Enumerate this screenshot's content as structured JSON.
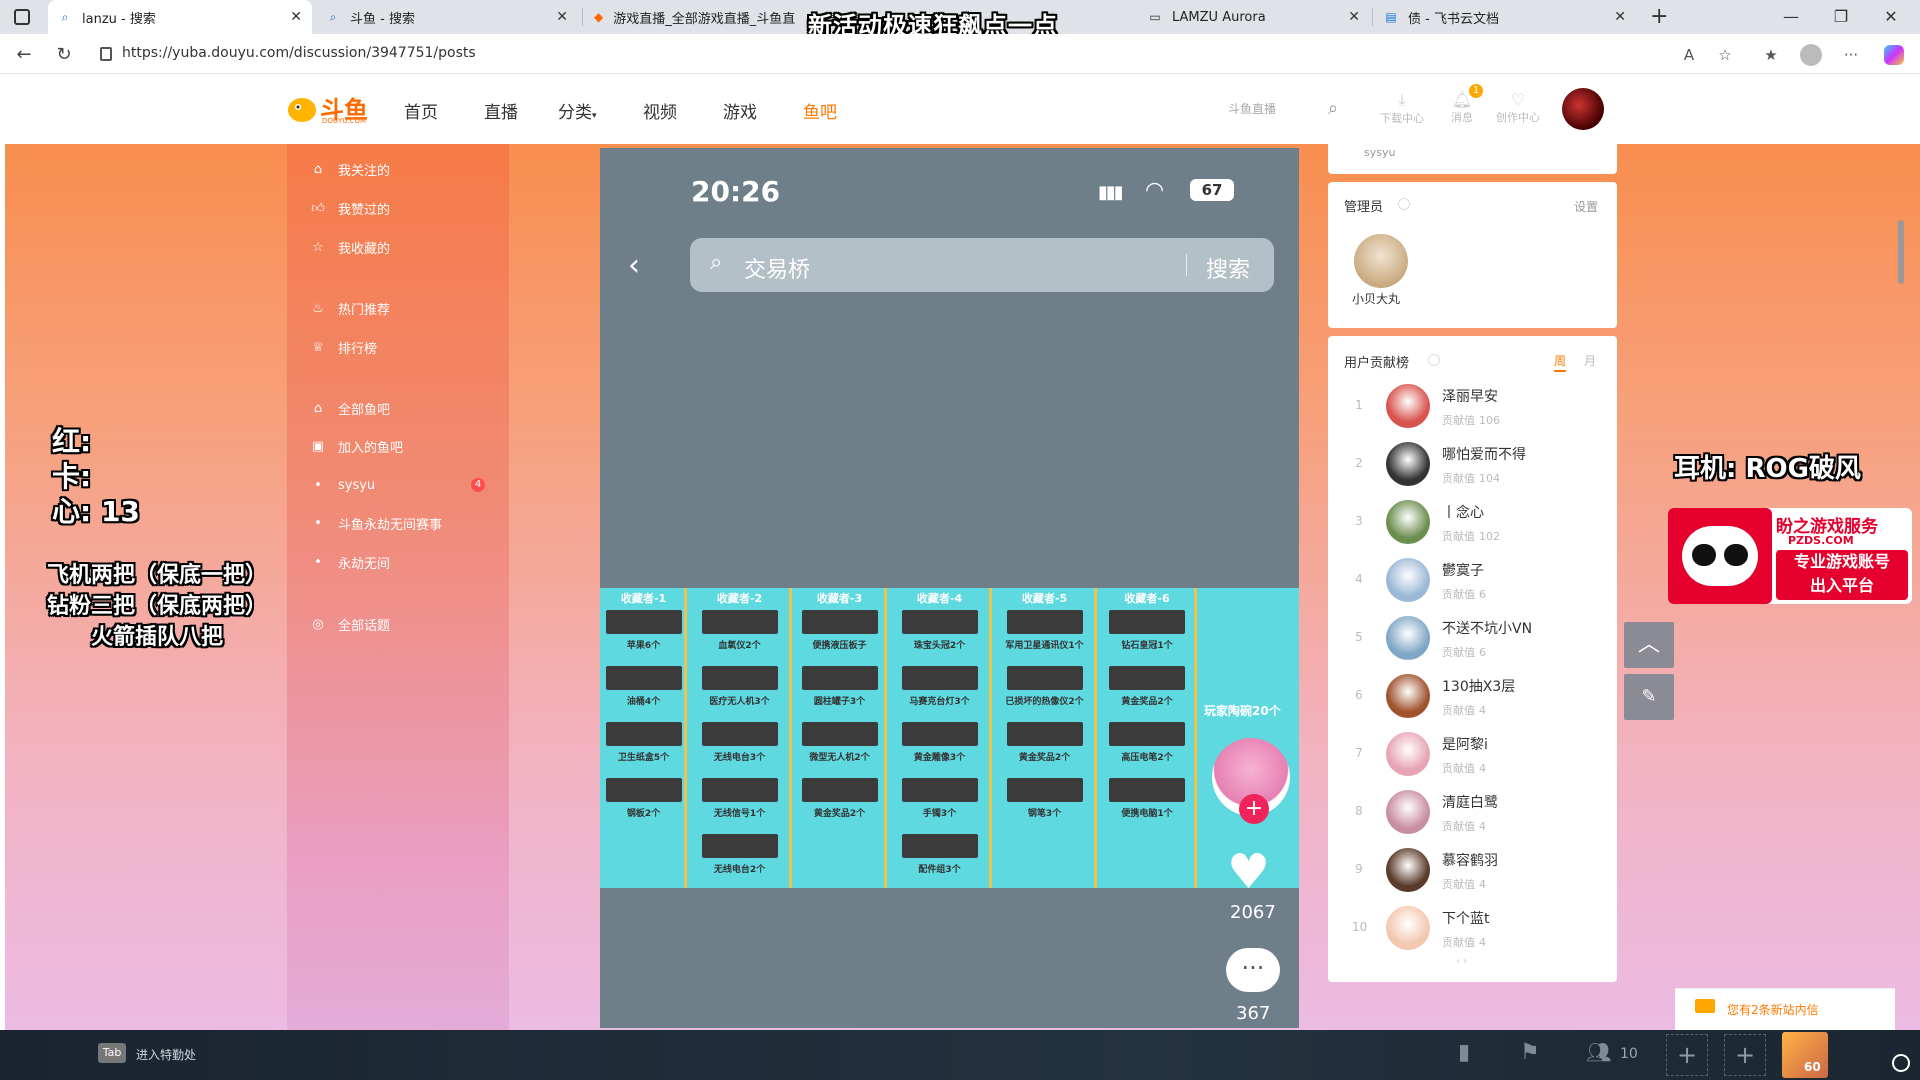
{
  "browser": {
    "tabs": [
      {
        "title": "lanzu - 搜索",
        "icon": "search-icon"
      },
      {
        "title": "斗鱼 - 搜索",
        "icon": "search-icon"
      },
      {
        "title": "游戏直播_全部游戏直播_斗鱼直",
        "icon": "douyu-icon"
      },
      {
        "title": "LAMZU Aurora",
        "icon": "lamzu-icon"
      },
      {
        "title": "债 - 飞书云文档",
        "icon": "doc-icon"
      }
    ],
    "url": "https://yuba.douyu.com/discussion/3947751/posts",
    "stream_banner": "新活动极速狂飙点一点"
  },
  "site": {
    "logo_text": "斗鱼",
    "logo_sub": "DOUYU.COM",
    "nav": [
      "首页",
      "直播",
      "分类",
      "视频",
      "游戏",
      "鱼吧"
    ],
    "active_nav": "鱼吧",
    "live_link": "斗鱼直播",
    "tools": [
      {
        "label": "下载中心",
        "icon": "download-icon"
      },
      {
        "label": "消息",
        "icon": "bell-icon",
        "badge": "1"
      },
      {
        "label": "创作中心",
        "icon": "creator-icon"
      }
    ]
  },
  "sidebar": {
    "items": [
      {
        "label": "我关注的",
        "icon": "house-icon"
      },
      {
        "label": "我赞过的",
        "icon": "thumb-icon"
      },
      {
        "label": "我收藏的",
        "icon": "star-icon"
      },
      {
        "label": "热门推荐",
        "icon": "fire-icon"
      },
      {
        "label": "排行榜",
        "icon": "trophy-icon"
      },
      {
        "label": "全部鱼吧",
        "icon": "house-icon"
      },
      {
        "label": "加入的鱼吧",
        "icon": "join-icon"
      },
      {
        "label": "sysyu",
        "icon": "dot-icon",
        "badge": "4"
      },
      {
        "label": "斗鱼永劫无间赛事",
        "icon": "dot-icon"
      },
      {
        "label": "永劫无间",
        "icon": "dot-icon"
      },
      {
        "label": "全部话题",
        "icon": "topic-icon"
      }
    ]
  },
  "overlay": {
    "left_lines": [
      "红:",
      "卡:",
      "心: 13"
    ],
    "left_notes": [
      "飞机两把（保底一把）",
      "钻粉三把（保底两把）",
      "火箭插队八把"
    ],
    "earphone": "耳机: ROG破风",
    "ad_title": "盼之游戏服务",
    "ad_domain": "PZDS.COM",
    "ad_line1": "专业游戏账号",
    "ad_line2": "出入平台"
  },
  "video": {
    "time": "20:26",
    "battery": "67",
    "search_text": "交易桥",
    "search_btn": "搜索",
    "collectors": [
      {
        "head": "收藏者-1",
        "items": [
          "苹果6个",
          "油桶4个",
          "卫生纸盒5个",
          "钢板2个"
        ]
      },
      {
        "head": "收藏者-2",
        "items": [
          "血氧仪2个",
          "医疗无人机3个",
          "无线电台3个",
          "无线信号1个",
          "无线电台2个"
        ]
      },
      {
        "head": "收藏者-3",
        "items": [
          "便携液压板子",
          "圆柱罐子3个",
          "微型无人机2个",
          "黄金奖品2个"
        ]
      },
      {
        "head": "收藏者-4",
        "items": [
          "珠宝头冠2个",
          "马赛克台灯3个",
          "黄金雕像3个",
          "手镯3个",
          "配件组3个"
        ]
      },
      {
        "head": "收藏者-5",
        "items": [
          "军用卫星通讯仪1个",
          "已损坏的热像仪2个",
          "黄金奖品2个",
          "钢笔3个"
        ]
      },
      {
        "head": "收藏者-6",
        "items": [
          "钻石皇冠1个",
          "黄金奖品2个",
          "高压电笔2个",
          "便携电脑1个"
        ]
      }
    ],
    "reward": "玩家陶碗20个",
    "likes": "2067",
    "comments": "367"
  },
  "right": {
    "prev_user": "sysyu",
    "admin_title": "管理员",
    "admin_settings": "设置",
    "admin_name": "小贝大丸",
    "rank_title": "用户贡献榜",
    "rank_tabs": [
      "周",
      "月"
    ],
    "rank_prefix": "贡献值",
    "ranks": [
      {
        "n": "1",
        "name": "泽丽早安",
        "val": "106",
        "color": "#d9534f"
      },
      {
        "n": "2",
        "name": "哪怕爱而不得",
        "val": "104",
        "color": "#333"
      },
      {
        "n": "3",
        "name": "丨念心",
        "val": "102",
        "color": "#6b8e4e"
      },
      {
        "n": "4",
        "name": "鬱寞子",
        "val": "6",
        "color": "#9bb8d6"
      },
      {
        "n": "5",
        "name": "不送不坑小VN",
        "val": "6",
        "color": "#7fa7c5"
      },
      {
        "n": "6",
        "name": "130抽X3层",
        "val": "4",
        "color": "#a0522d"
      },
      {
        "n": "7",
        "name": "是阿黎i",
        "val": "4",
        "color": "#e6a5b4"
      },
      {
        "n": "8",
        "name": "清庭白鹭",
        "val": "4",
        "color": "#c88fa0"
      },
      {
        "n": "9",
        "name": "慕容鹤羽",
        "val": "4",
        "color": "#5a3a2a"
      },
      {
        "n": "10",
        "name": "下个蓝t",
        "val": "4",
        "color": "#f3c8b0"
      }
    ],
    "notice": "您有2条新站内信"
  },
  "taskbar": {
    "tab_key": "Tab",
    "tab_label": "进入特勤处",
    "count": "10",
    "avatar_num": "60"
  }
}
